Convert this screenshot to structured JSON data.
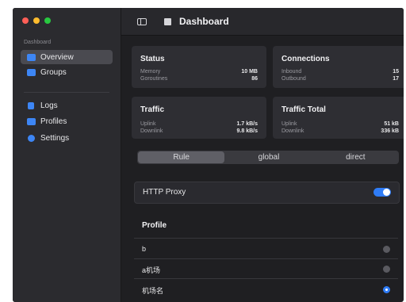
{
  "window": {
    "traffic_lights": {
      "close": "#ff5f57",
      "minimize": "#febc2e",
      "zoom": "#28c840"
    }
  },
  "sidebar": {
    "section": "Dashboard",
    "items": [
      {
        "label": "Overview",
        "icon": "overview-icon",
        "active": true
      },
      {
        "label": "Groups",
        "icon": "groups-icon"
      },
      {
        "label": "Logs",
        "icon": "logs-icon"
      },
      {
        "label": "Profiles",
        "icon": "profiles-icon"
      },
      {
        "label": "Settings",
        "icon": "settings-icon"
      }
    ]
  },
  "topbar": {
    "title": "Dashboard",
    "icons": [
      "sidebar-toggle-icon",
      "stop-icon"
    ]
  },
  "cards": {
    "status": {
      "title": "Status",
      "rows": [
        {
          "k": "Memory",
          "v": "10 MB"
        },
        {
          "k": "Goroutines",
          "v": "86"
        }
      ]
    },
    "connections": {
      "title": "Connections",
      "rows": [
        {
          "k": "Inbound",
          "v": "15"
        },
        {
          "k": "Outbound",
          "v": "17"
        }
      ]
    },
    "traffic": {
      "title": "Traffic",
      "rows": [
        {
          "k": "Uplink",
          "v": "1.7 kB/s"
        },
        {
          "k": "Downlink",
          "v": "9.8 kB/s"
        }
      ]
    },
    "traffic_total": {
      "title": "Traffic Total",
      "rows": [
        {
          "k": "Uplink",
          "v": "51 kB"
        },
        {
          "k": "Downlink",
          "v": "336 kB"
        }
      ]
    }
  },
  "mode": {
    "options": [
      "Rule",
      "global",
      "direct"
    ],
    "selected": "Rule"
  },
  "http_proxy": {
    "label": "HTTP Proxy",
    "enabled": true
  },
  "profile": {
    "heading": "Profile",
    "items": [
      {
        "name": "b",
        "selected": false
      },
      {
        "name": "a机场",
        "selected": false
      },
      {
        "name": "机场名",
        "selected": true
      }
    ]
  },
  "colors": {
    "accent": "#2f7cf6",
    "background": "#1f1f22",
    "sidebar": "#2b2b2f",
    "card": "#2e2e33"
  }
}
